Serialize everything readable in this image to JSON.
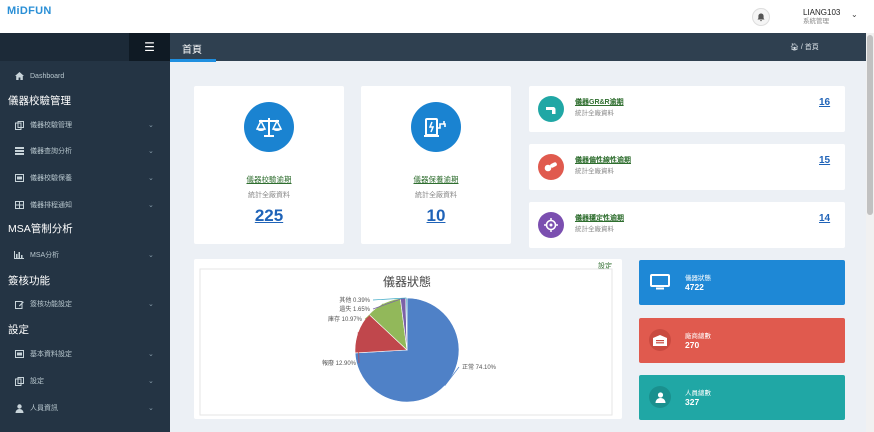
{
  "brand": "MiDFUN",
  "user": {
    "name": "LIANG103",
    "role": "系統管理"
  },
  "sidebar": {
    "dashboard": "Dashboard",
    "sections": [
      {
        "title": "儀器校驗管理",
        "items": [
          "儀器校驗管理",
          "儀器查詢分析",
          "儀器校驗保養",
          "儀器排程通知"
        ]
      },
      {
        "title": "MSA管制分析",
        "items": [
          "MSA分析"
        ]
      },
      {
        "title": "簽核功能",
        "items": [
          "簽核功能設定"
        ]
      },
      {
        "title": "設定",
        "items": [
          "基本資料設定",
          "設定",
          "人員資訊"
        ]
      }
    ]
  },
  "header": {
    "title": "首頁",
    "breadcrumb": "首頁"
  },
  "cards": [
    {
      "title": "儀器校驗逾期",
      "sub": "統計全廠資料",
      "value": "225"
    },
    {
      "title": "儀器保養逾期",
      "sub": "統計全廠資料",
      "value": "10"
    }
  ],
  "small_cards": [
    {
      "title": "儀器GR&R逾期",
      "sub": "統計全廠資料",
      "value": "16"
    },
    {
      "title": "儀器偏性線性逾期",
      "sub": "統計全廠資料",
      "value": "15"
    },
    {
      "title": "儀器穩定性逾期",
      "sub": "統計全廠資料",
      "value": "14"
    }
  ],
  "stats": [
    {
      "label": "儀器狀態",
      "value": "4722",
      "color": "#1e88d6"
    },
    {
      "label": "廠商總數",
      "value": "270",
      "color": "#e05a4e"
    },
    {
      "label": "人員總數",
      "value": "327",
      "color": "#20a7a5"
    }
  ],
  "chart": {
    "settings_link": "設定"
  },
  "chart_data": {
    "type": "pie",
    "title": "儀器狀態",
    "slices": [
      {
        "label": "正常",
        "value": 74.1,
        "text": "正常 74.10%",
        "color": "#4f81c7"
      },
      {
        "label": "報廢",
        "value": 12.9,
        "text": "報廢 12.90%",
        "color": "#c0474c"
      },
      {
        "label": "庫存",
        "value": 10.97,
        "text": "庫存 10.97%",
        "color": "#92b85a"
      },
      {
        "label": "遺失",
        "value": 1.65,
        "text": "遺失 1.65%",
        "color": "#7b62a8"
      },
      {
        "label": "其他",
        "value": 0.39,
        "text": "其他 0.39%",
        "color": "#3aa8c5"
      }
    ]
  }
}
